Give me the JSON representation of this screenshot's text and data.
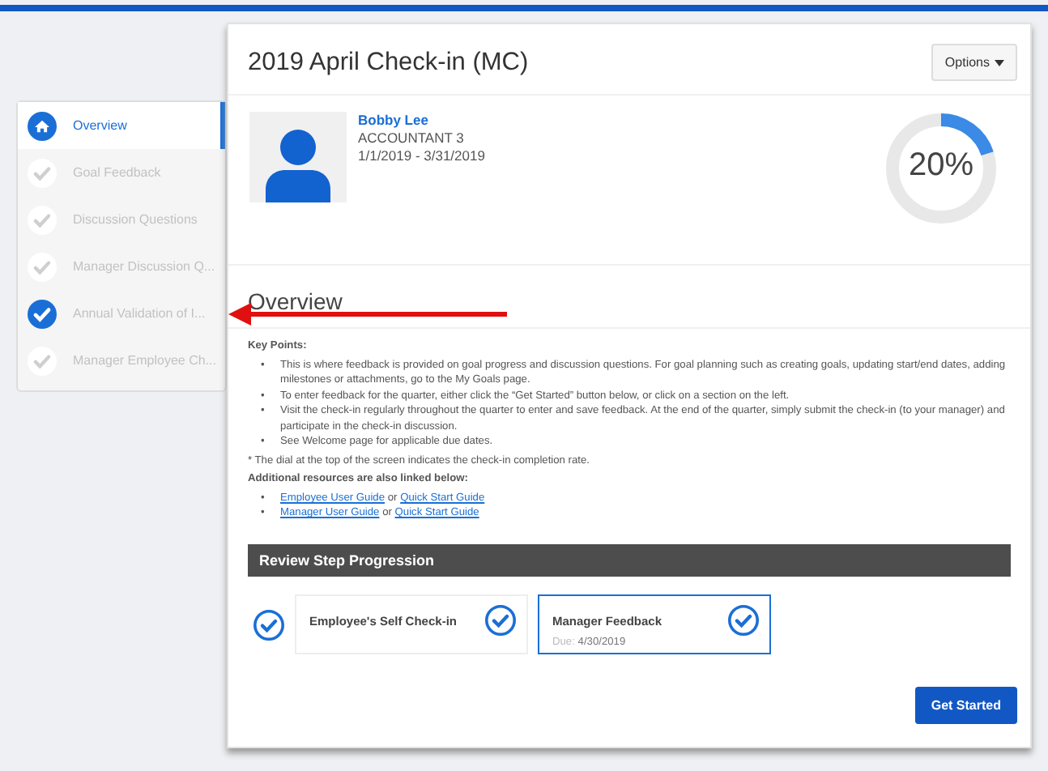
{
  "sidebar": {
    "items": [
      {
        "label": "Overview",
        "kind": "home",
        "filled": true,
        "selected": true
      },
      {
        "label": "Goal Feedback",
        "kind": "check",
        "filled": false,
        "selected": false
      },
      {
        "label": "Discussion Questions",
        "kind": "check",
        "filled": false,
        "selected": false
      },
      {
        "label": "Manager Discussion Q...",
        "kind": "check",
        "filled": false,
        "selected": false
      },
      {
        "label": "Annual Validation of I...",
        "kind": "check",
        "filled": true,
        "selected": false
      },
      {
        "label": "Manager Employee Ch...",
        "kind": "check",
        "filled": false,
        "selected": false
      }
    ]
  },
  "header": {
    "title": "2019 April Check-in (MC)",
    "options_button": "Options"
  },
  "profile": {
    "name": "Bobby Lee",
    "job_title": "ACCOUNTANT 3",
    "period": "1/1/2019 - 3/31/2019",
    "completion": {
      "level": 0.2,
      "reading": "20%"
    }
  },
  "overview": {
    "heading": "Overview",
    "bullet": "•",
    "key_points_label": "Key Points:",
    "key_points": [
      "This is where feedback is provided on goal progress and discussion questions. For goal planning such as creating goals, updating start/end dates, adding milestones or attachments, go to the My Goals page.",
      "To enter feedback for the quarter, either click the “Get Started” button below, or click on a section on the left.",
      "Visit the check-in regularly throughout the quarter to enter and save feedback. At the end of the quarter, simply submit the check-in (to your manager) and participate in the check-in discussion.",
      "See Welcome page for applicable due dates."
    ],
    "note": "* The dial at the top of the screen indicates the check-in completion rate.",
    "resources_label": "Additional resources are also linked below:",
    "resources": [
      {
        "links": [
          "Employee User Guide",
          "Quick Start Guide"
        ],
        "joiner": "or"
      },
      {
        "links": [
          "Manager User Guide",
          "Quick Start Guide"
        ],
        "joiner": "or"
      }
    ]
  },
  "review": {
    "title": "Review Step Progression",
    "steps": [
      {
        "title": "Employee's Self Check-in",
        "selected": false
      },
      {
        "title": "Manager Feedback",
        "due_label": "Due:",
        "due": "4/30/2019",
        "selected": true
      }
    ]
  },
  "get_started_button": "Get Started"
}
